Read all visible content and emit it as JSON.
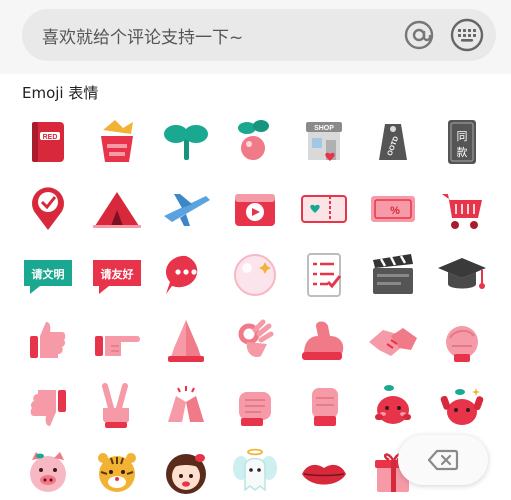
{
  "input": {
    "placeholder": "喜欢就给个评论支持一下~"
  },
  "toolbar": {
    "at_icon": "at-sign-icon",
    "keyboard_icon": "keyboard-icon"
  },
  "section": {
    "title": "Emoji 表情"
  },
  "emoji_rows": [
    [
      "red-book",
      "gift-basket",
      "sprout",
      "fruit-branch",
      "shop",
      "ootd-tag",
      "same-style-tag"
    ],
    [
      "check-pin",
      "tent",
      "airplane",
      "camera",
      "ticket",
      "coupon",
      "shopping-cart"
    ],
    [
      "please-civil-speech-badge",
      "please-be-friendly-badge",
      "chat-bubble",
      "bubble-glow",
      "checklist",
      "clapperboard",
      "graduation-cap"
    ],
    [
      "thumbs-up",
      "pointing-hand",
      "praying-hands",
      "ok-hand",
      "muscle-arm",
      "handshake",
      "fist-salute"
    ],
    [
      "thumbs-down",
      "victory-hand",
      "clapping-hands",
      "hand-wave",
      "fist-bump",
      "peach-creature",
      "peach-creature-cheer"
    ],
    [
      "pig-face",
      "tiger-face",
      "girl-face",
      "angel-ghost",
      "lips",
      "gift-box"
    ]
  ],
  "badges": {
    "please_civil": "请文明",
    "please_friendly": "请友好",
    "same_style": "同款",
    "ootd": "OOTD",
    "red": "RED",
    "shop": "SHOP"
  },
  "delete": {
    "icon": "backspace-icon"
  },
  "colors": {
    "accent_red": "#e8344a",
    "pink": "#f59aa6",
    "teal": "#1aa890",
    "gray": "#8a8a8a"
  }
}
